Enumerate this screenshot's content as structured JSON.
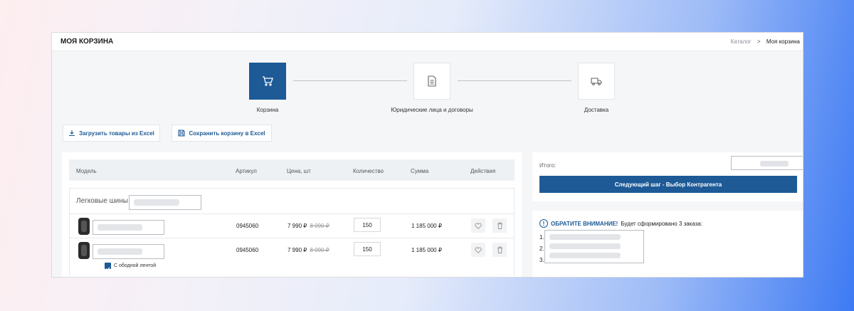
{
  "header": {
    "title": "МОЯ КОРЗИНА",
    "breadcrumb": {
      "catalog": "Каталог",
      "separator": ">",
      "current": "Моя корзина"
    }
  },
  "steps": [
    {
      "label": "Корзина",
      "icon": "cart-icon",
      "active": true
    },
    {
      "label": "Юридические лица и договоры",
      "icon": "document-icon",
      "active": false
    },
    {
      "label": "Доставка",
      "icon": "truck-icon",
      "active": false
    }
  ],
  "actions": {
    "upload_excel": "Загрузить товары из Excel",
    "save_excel": "Сохранить корзину в Excel"
  },
  "table": {
    "columns": [
      "Модель",
      "Артикул",
      "Цена, шт",
      "Количество",
      "Сумма",
      "Действия"
    ],
    "group_title": "Легковые шины",
    "rows": [
      {
        "article": "0945060",
        "price": "7 990 ₽",
        "old_price": "8 990 ₽",
        "qty": "150",
        "sum": "1 185 000 ₽"
      },
      {
        "article": "0945060",
        "price": "7 990 ₽",
        "old_price": "8 990 ₽",
        "qty": "150",
        "sum": "1 185 000 ₽",
        "option": "С ободной лентой"
      }
    ]
  },
  "summary": {
    "total_label": "Итого:",
    "next_button": "Следующий шаг - Выбор Контрагента"
  },
  "notice": {
    "title": "ОБРАТИТЕ ВНИМАНИЕ!",
    "text": "Будет сформировано 3 заказа:",
    "items": [
      "1.",
      "2.",
      "3."
    ]
  },
  "colors": {
    "accent": "#1d5a96"
  }
}
